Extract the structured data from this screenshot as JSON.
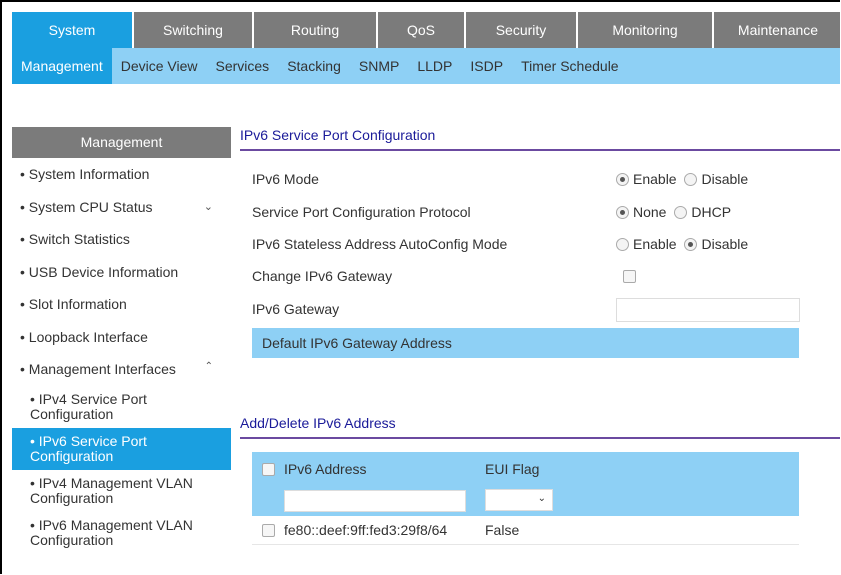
{
  "top_tabs": [
    "System",
    "Switching",
    "Routing",
    "QoS",
    "Security",
    "Monitoring",
    "Maintenance"
  ],
  "sub_tabs": [
    "Management",
    "Device View",
    "Services",
    "Stacking",
    "SNMP",
    "LLDP",
    "ISDP",
    "Timer Schedule"
  ],
  "sidebar": {
    "title": "Management",
    "items": [
      "System Information",
      "System CPU Status",
      "Switch Statistics",
      "USB Device Information",
      "Slot Information",
      "Loopback Interface",
      "Management Interfaces"
    ],
    "subitems": [
      "IPv4 Service Port Configuration",
      "IPv6 Service Port Configuration",
      "IPv4 Management VLAN Configuration",
      "IPv6 Management VLAN Configuration"
    ]
  },
  "config": {
    "title": "IPv6 Service Port Configuration",
    "ipv6_mode_label": "IPv6 Mode",
    "ipv6_mode_options": [
      "Enable",
      "Disable"
    ],
    "ipv6_mode_selected": "Enable",
    "protocol_label": "Service Port Configuration Protocol",
    "protocol_options": [
      "None",
      "DHCP"
    ],
    "protocol_selected": "None",
    "autoconfig_label": "IPv6 Stateless Address AutoConfig Mode",
    "autoconfig_options": [
      "Enable",
      "Disable"
    ],
    "autoconfig_selected": "Disable",
    "change_gateway_label": "Change IPv6 Gateway",
    "gateway_label": "IPv6 Gateway",
    "gateway_value": "",
    "default_gateway_label": "Default IPv6 Gateway Address"
  },
  "address_table": {
    "title": "Add/Delete IPv6 Address",
    "columns": [
      "IPv6 Address",
      "EUI Flag"
    ],
    "new_address_value": "",
    "new_eui_value": "",
    "rows": [
      {
        "address": "fe80::deef:9ff:fed3:29f8/64",
        "eui": "False"
      }
    ]
  },
  "colors": {
    "active_blue": "#1a9fe0",
    "light_blue": "#8ed0f5",
    "nav_gray": "#7b7b7b",
    "title_underline": "#6b4aa0"
  }
}
